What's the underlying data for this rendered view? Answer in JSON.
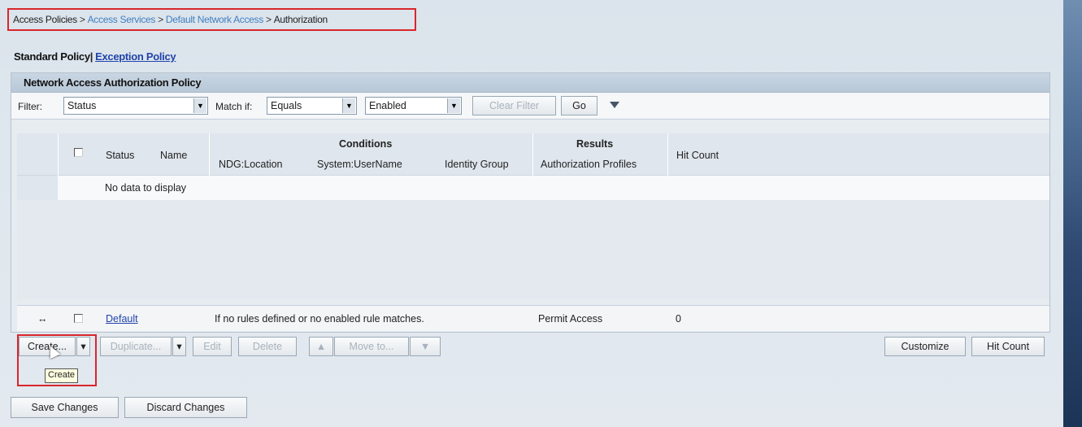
{
  "breadcrumb": {
    "items": [
      "Access Policies",
      "Access Services",
      "Default Network Access",
      "Authorization"
    ],
    "separator": ">"
  },
  "policy_tabs": {
    "standard": "Standard Policy",
    "separator": "|",
    "exception": "Exception Policy"
  },
  "panel": {
    "title": "Network Access Authorization Policy"
  },
  "filter": {
    "label": "Filter:",
    "field_value": "Status",
    "match_label": "Match if:",
    "match_value": "Equals",
    "value_value": "Enabled",
    "clear_filter": "Clear Filter",
    "go": "Go"
  },
  "table": {
    "headers": {
      "status": "Status",
      "name": "Name",
      "conditions": "Conditions",
      "ndg_location": "NDG:Location",
      "system_username": "System:UserName",
      "identity_group": "Identity Group",
      "results": "Results",
      "authorization_profiles": "Authorization Profiles",
      "hit_count": "Hit Count"
    },
    "empty_text": "No data to display",
    "default_row": {
      "marker": "↔",
      "name": "Default",
      "conditions": "If no rules defined or no enabled rule matches.",
      "profile": "Permit Access",
      "hit_count": "0"
    }
  },
  "actions": {
    "create": "Create...",
    "duplicate": "Duplicate...",
    "edit": "Edit",
    "delete": "Delete",
    "move_to": "Move to...",
    "customize": "Customize",
    "hit_count": "Hit Count",
    "tooltip": "Create"
  },
  "footer": {
    "save": "Save Changes",
    "discard": "Discard Changes"
  },
  "colors": {
    "highlight": "#d9262c",
    "link": "#2244aa",
    "breadcrumb_link": "#3f7fc0"
  }
}
